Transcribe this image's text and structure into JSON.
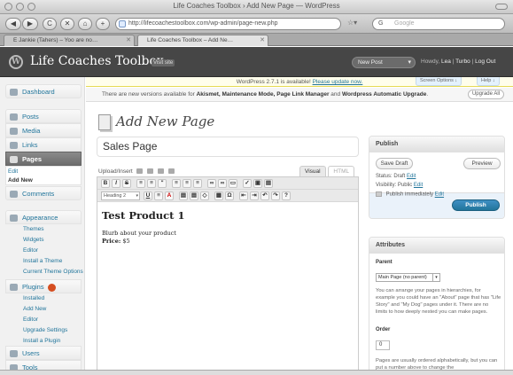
{
  "browser": {
    "window_title": "Life Coaches Toolbox › Add New Page — WordPress",
    "back_label": "◀",
    "forward_label": "▶",
    "reload_label": "C",
    "stop_label": "✕",
    "home_label": "⌂",
    "url": "http://lifecoachestoolbox.com/wp-admin/page-new.php",
    "rss_label": "☆▾",
    "search_engine": "G",
    "search_placeholder": "Google",
    "tabs": [
      {
        "label": "E Jankie (Tahers) – Yoo are no…",
        "active": false
      },
      {
        "label": "Life Coaches Toolbox – Add Ne…",
        "active": true
      }
    ]
  },
  "wp_header": {
    "logo": "W",
    "site_title": "Life Coaches Toolbox",
    "visit_site": "Visit site",
    "new_post": "New Post",
    "howdy_prefix": "Howdy,",
    "user": "Lea",
    "turbo": "Turbo",
    "logout": "Log Out"
  },
  "notices": {
    "update_text": "WordPress 2.7.1 is available!",
    "update_link": "Please update now.",
    "screen_options": "Screen Options ↓",
    "help": "Help ↓",
    "plugin_text": "There are new versions available for ",
    "plugin_names": "Akismet, Maintenance Mode, Page Link Manager",
    "plugin_and": " and ",
    "plugin_last": "Wordpress Automatic Upgrade",
    "plugin_end": ".",
    "upgrade_all": "Upgrade All"
  },
  "menu": {
    "dashboard": "Dashboard",
    "posts": "Posts",
    "media": "Media",
    "links": "Links",
    "pages": "Pages",
    "pages_sub": [
      "Edit",
      "Add New"
    ],
    "comments": "Comments",
    "appearance": "Appearance",
    "appearance_sub": [
      "Themes",
      "Widgets",
      "Editor",
      "Install a Theme",
      "Current Theme Options"
    ],
    "plugins": "Plugins",
    "plugins_sub": [
      "Installed",
      "Add New",
      "Editor",
      "Upgrade Settings",
      "Install a Plugin"
    ],
    "users": "Users",
    "tools": "Tools"
  },
  "main": {
    "page_heading": "Add New Page",
    "title_value": "Sales Page",
    "upload_insert": "Upload/Insert",
    "visual_tab": "Visual",
    "html_tab": "HTML",
    "format_select": "Heading 2",
    "content_heading": "Test Product 1",
    "content_line1": "Blurb about your product",
    "content_price_label": "Price:",
    "content_price_value": "$5"
  },
  "publish_box": {
    "title": "Publish",
    "save_draft": "Save Draft",
    "preview": "Preview",
    "status_label": "Status: Draft",
    "status_edit": "Edit",
    "visibility_label": "Visibility: Public",
    "visibility_edit": "Edit",
    "publish_immediately": "Publish immediately",
    "publish_edit": "Edit",
    "publish_button": "Publish"
  },
  "attributes_box": {
    "title": "Attributes",
    "parent_label": "Parent",
    "parent_value": "Main Page (no parent)",
    "parent_help": "You can arrange your pages in hierarchies, for example you could have an \"About\" page that has \"Life Story\" and \"My Dog\" pages under it. There are no limits to how deeply nested you can make pages.",
    "order_label": "Order",
    "order_value": "0",
    "order_help": "Pages are usually ordered alphabetically, but you can put a number above to change the"
  },
  "colors": {
    "wp_header": "#464646",
    "link": "#21759b",
    "publish_blue": "#21759b",
    "plugin_badge": "#d54e21"
  }
}
